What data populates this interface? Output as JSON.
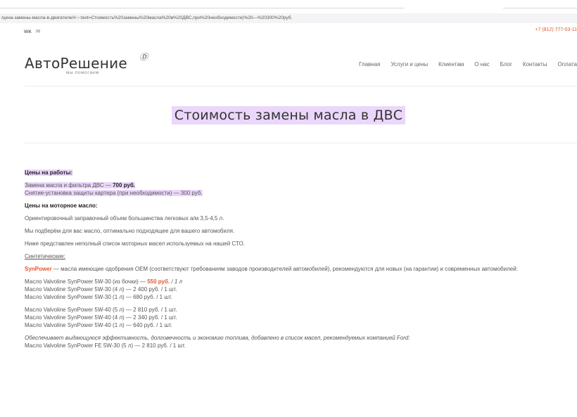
{
  "browser": {
    "url": "/цена-замены-масла-в-двигателе/#:~:text=Стоимость%20замены%20масла%20в%20ДВС,при%20необходимости)%20—%20300%20руб."
  },
  "topbar": {
    "social_vk": "ᴡᴋ",
    "social_mail": "✉",
    "phone": "+7 (812) 777-03-11"
  },
  "logo": {
    "name": "АвтоРешение",
    "mark": "Ⓓ",
    "tagline": "мы помогаем"
  },
  "nav": {
    "items": [
      "Главная",
      "Услуги и цены",
      "Клиентам",
      "О нас",
      "Блог",
      "Контакты",
      "Оплата"
    ]
  },
  "page": {
    "title": "Стоимость замены масла в ДВС"
  },
  "content": {
    "works_heading": "Цены на работы:",
    "work1_text": "Замена масла и фильтра ДВС — ",
    "work1_price": "700 руб.",
    "work2": "Снятие-установка защиты картера (при необходимости) — 300 руб.",
    "oil_heading": "Цены на моторное масло:",
    "oil_p1": "Ориентировочный заправочный объем большинства легковых а/м 3,5-4,5 л.",
    "oil_p2": "Мы подберём для вас масло, оптимально подходящее для вашего автомобиля.",
    "oil_p3": "Ниже представлен неполный список моторных масел используемых на нашей СТО.",
    "synth_heading": "Синтетические:",
    "synpower_brand": "SynPower",
    "synpower_desc": " — масла имеющие одобрения OEM (соответствуют требованиям заводов производителей автомобилей), рекомендуются для новых (на гарантии) и современных автомобилей:",
    "g1_l1_text": "Масло Valvoline SynPower 5W-30 (из бочки) — ",
    "g1_l1_price": "550 руб.",
    "g1_l1_unit": " / 1 л",
    "g1_l2": "Масло Valvoline SynPower 5W-30 (4 л) — 2 400  руб. / 1 шт.",
    "g1_l3": "Масло Valvoline SynPower 5W-30 (1 л) — 680 руб. / 1 шт.",
    "g2_l1": "Масло Valvoline SynPower 5W-40 (5 л) — 2 810  руб. / 1 шт.",
    "g2_l2": "Масло Valvoline SynPower 5W-40 (4 л) — 2 340  руб. / 1 шт.",
    "g2_l3": "Масло Valvoline SynPower 5W-40 (1 л) — 640 руб. / 1 шт.",
    "ford_note": "Обеспечивает выдающуюся эффективность, долговечность и экономию топлива, добавлено в список масел, рекомендуемых компанией Ford:",
    "g3_l1": "Масло Valvoline SynPower FE 5W-30 (5 л) — 2 810 руб. / 1 шт."
  }
}
